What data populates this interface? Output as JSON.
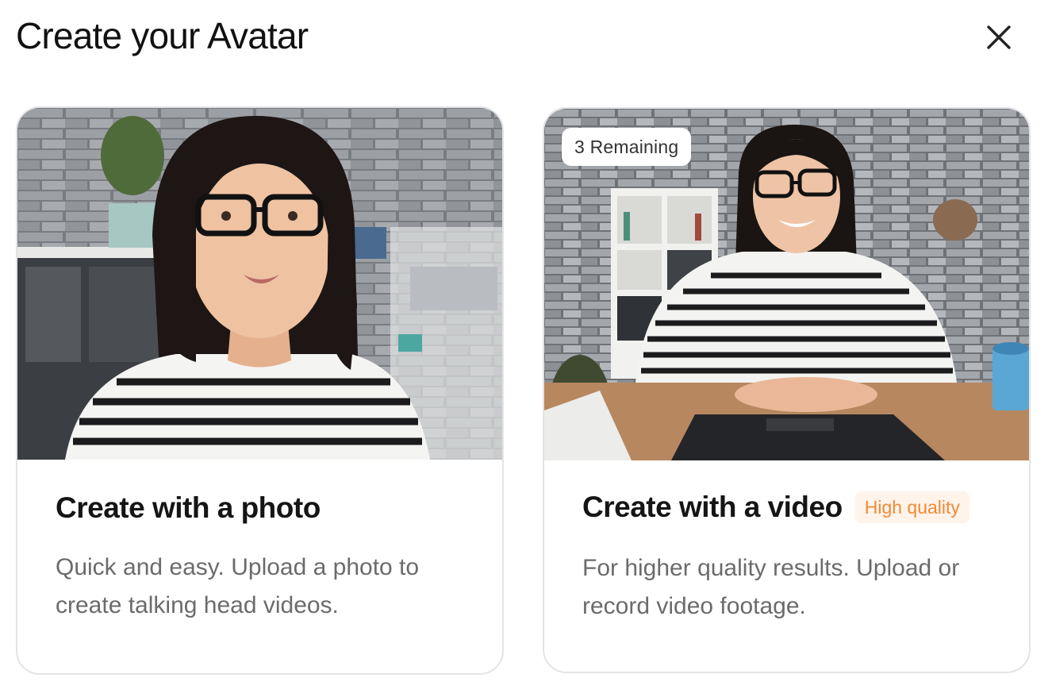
{
  "dialog": {
    "title": "Create your Avatar"
  },
  "cards": {
    "photo": {
      "title": "Create with a photo",
      "description": "Quick and easy. Upload a photo to create talking head videos.",
      "image": "woman-portrait-photo"
    },
    "video": {
      "title": "Create with a video",
      "badge": "High quality",
      "remaining": "3 Remaining",
      "description": "For higher quality results. Upload or record video footage.",
      "image": "woman-at-desk-video"
    }
  },
  "icons": {
    "close": "close-icon"
  },
  "colors": {
    "badge_text": "#f08a36",
    "badge_bg": "#fff3ea",
    "card_border": "#e4e4e7"
  }
}
